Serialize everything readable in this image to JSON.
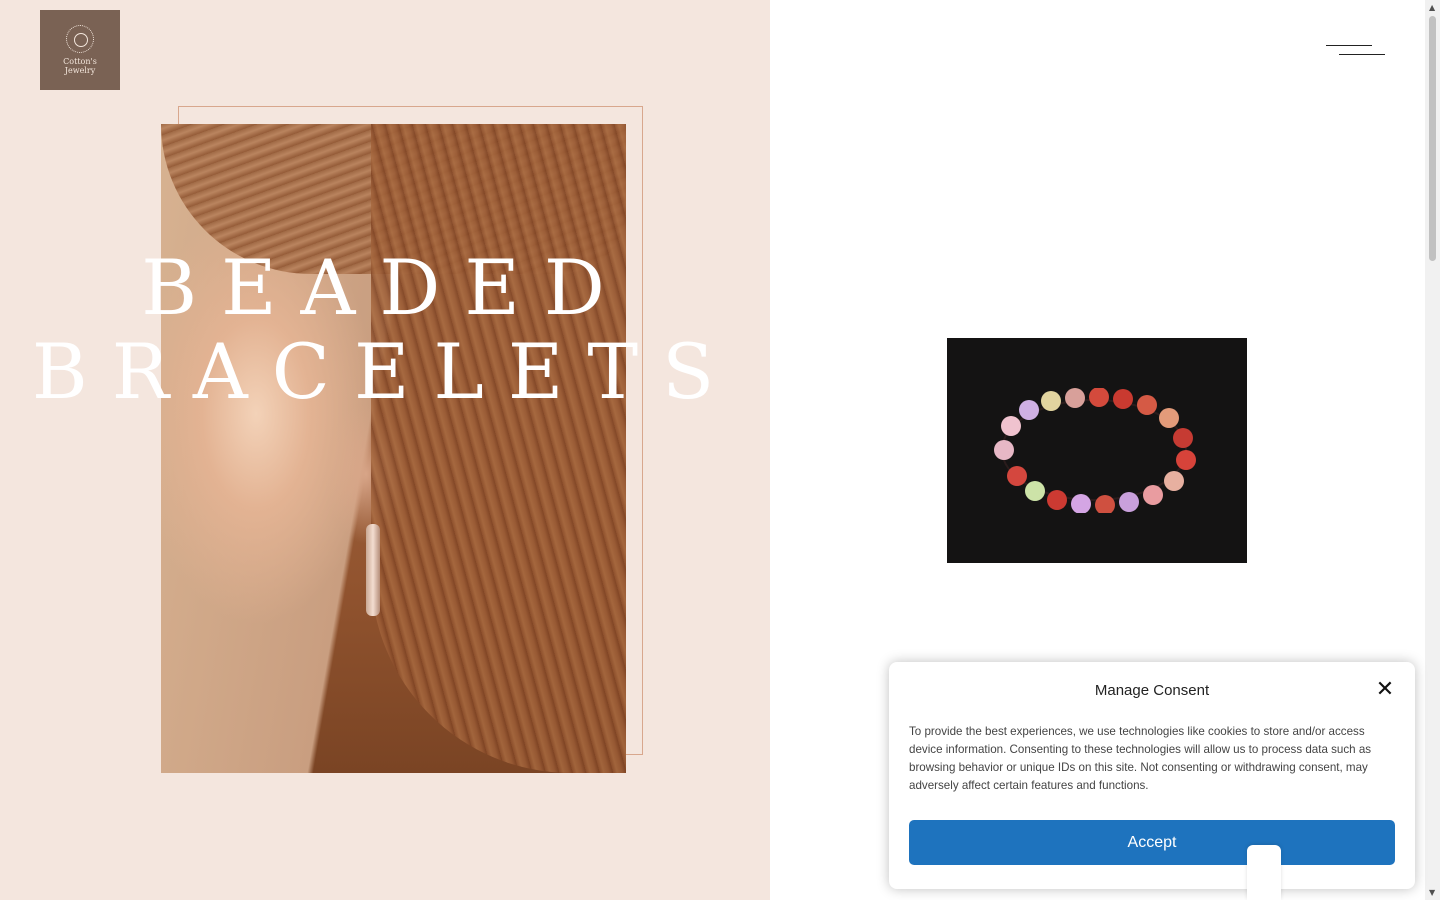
{
  "logo": {
    "line1": "Cotton's",
    "line2": "Jewelry",
    "icon": "beaded-ring-icon",
    "bg_color": "#7a6254"
  },
  "hero": {
    "line1": "BEADED",
    "line2": "BRACELETS"
  },
  "menu": {
    "icon": "hamburger-menu-icon"
  },
  "product_image": {
    "icon": "beaded-bracelet-image"
  },
  "consent": {
    "title": "Manage Consent",
    "body": "To provide the best experiences, we use technologies like cookies to store and/or access device information. Consenting to these technologies will allow us to process data such as browsing behavior or unique IDs on this site. Not consenting or withdrawing consent, may adversely affect certain features and functions.",
    "close_icon": "close-icon",
    "accept_label": "Accept",
    "accent_color": "#1e73be"
  },
  "colors": {
    "left_panel_bg": "#f4e6de",
    "frame_border": "#d8a78d"
  }
}
